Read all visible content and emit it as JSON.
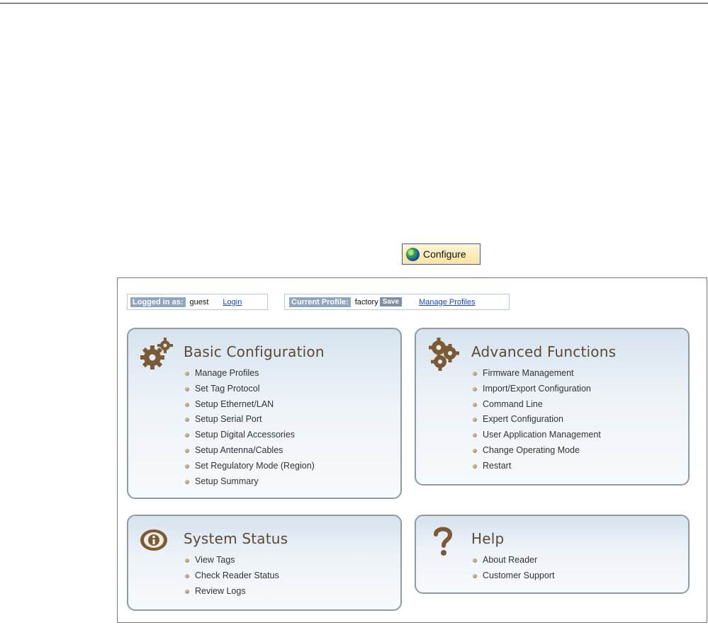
{
  "configure_button": {
    "label": "Configure",
    "icon": "globe-icon"
  },
  "session": {
    "logged_in_label": "Logged in as:",
    "user": "guest",
    "login_link": "Login",
    "profile_label": "Current Profile:",
    "profile_name": "factory",
    "save_label": "Save",
    "manage_profiles_link": "Manage Profiles"
  },
  "cards": {
    "basic": {
      "title": "Basic Configuration",
      "icon": "gears-icon",
      "items": [
        "Manage Profiles",
        "Set Tag Protocol",
        "Setup Ethernet/LAN",
        "Setup Serial Port",
        "Setup Digital Accessories",
        "Setup Antenna/Cables",
        "Set Regulatory Mode (Region)",
        "Setup Summary"
      ]
    },
    "advanced": {
      "title": "Advanced Functions",
      "icon": "multi-gears-icon",
      "items": [
        "Firmware Management",
        "Import/Export Configuration",
        "Command Line",
        "Expert Configuration",
        "User Application Management",
        "Change Operating Mode",
        "Restart"
      ]
    },
    "status": {
      "title": "System Status",
      "icon": "info-icon",
      "items": [
        "View Tags",
        "Check Reader Status",
        "Review Logs"
      ]
    },
    "help": {
      "title": "Help",
      "icon": "question-mark-icon",
      "items": [
        "About Reader",
        "Customer Support"
      ]
    }
  },
  "colors": {
    "title_brown": "#5a4a36",
    "link_blue": "#1846c8",
    "label_bg": "#8fa5c0",
    "card_border": "#8e9aa7"
  }
}
